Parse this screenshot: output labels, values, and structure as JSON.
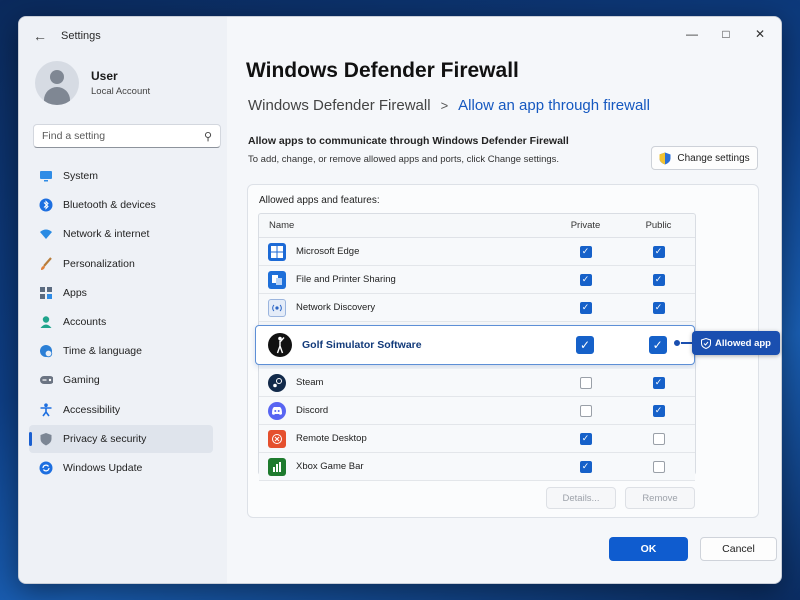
{
  "titlebar": {
    "title": "Settings"
  },
  "profile": {
    "name": "User",
    "subtitle": "Local Account"
  },
  "search": {
    "placeholder": "Find a setting"
  },
  "sidebar": {
    "items": [
      {
        "label": "System",
        "icon": "monitor-icon",
        "active": false
      },
      {
        "label": "Bluetooth & devices",
        "icon": "bluetooth-icon",
        "active": false
      },
      {
        "label": "Network & internet",
        "icon": "wifi-icon",
        "active": false
      },
      {
        "label": "Personalization",
        "icon": "brush-icon",
        "active": false
      },
      {
        "label": "Apps",
        "icon": "apps-icon",
        "active": false
      },
      {
        "label": "Accounts",
        "icon": "person-icon",
        "active": false
      },
      {
        "label": "Time & language",
        "icon": "globe-clock-icon",
        "active": false
      },
      {
        "label": "Gaming",
        "icon": "gamepad-icon",
        "active": false
      },
      {
        "label": "Accessibility",
        "icon": "accessibility-icon",
        "active": false
      },
      {
        "label": "Privacy & security",
        "icon": "shield-icon",
        "active": true
      },
      {
        "label": "Windows Update",
        "icon": "update-icon",
        "active": false
      }
    ]
  },
  "main": {
    "title": "Windows Defender Firewall",
    "breadcrumb": {
      "parent": "Windows Defender Firewall",
      "separator": ">",
      "current": "Allow an app through firewall"
    },
    "desc_title": "Allow apps to communicate through Windows Defender Firewall",
    "desc_sub": "To add, change, or remove allowed apps and ports, click Change settings.",
    "change_settings": "Change settings",
    "panel_label": "Allowed apps and features:",
    "columns": {
      "name": "Name",
      "private": "Private",
      "public": "Public"
    },
    "apps_before": [
      {
        "name": "Microsoft Edge",
        "icon": "edge-icon",
        "private": true,
        "public": true
      },
      {
        "name": "File and Printer Sharing",
        "icon": "file-share-icon",
        "private": true,
        "public": true
      },
      {
        "name": "Network Discovery",
        "icon": "network-discovery-icon",
        "private": true,
        "public": true
      }
    ],
    "highlighted_app": {
      "name": "Golf Simulator Software",
      "icon": "golfer-icon",
      "private": true,
      "public": true
    },
    "apps_after": [
      {
        "name": "Steam",
        "icon": "steam-icon",
        "private": false,
        "public": true
      },
      {
        "name": "Discord",
        "icon": "discord-icon",
        "private": false,
        "public": true
      },
      {
        "name": "Remote Desktop",
        "icon": "remote-desktop-icon",
        "private": true,
        "public": false
      },
      {
        "name": "Xbox Game Bar",
        "icon": "xbox-game-bar-icon",
        "private": true,
        "public": false
      }
    ],
    "details_button": "Details...",
    "remove_button": "Remove",
    "ok_button": "OK",
    "cancel_button": "Cancel"
  },
  "callout": {
    "label": "Allowed app"
  },
  "colors": {
    "accent": "#1661c9",
    "callout": "#1a4fb0",
    "ok": "#0f5ccf"
  }
}
